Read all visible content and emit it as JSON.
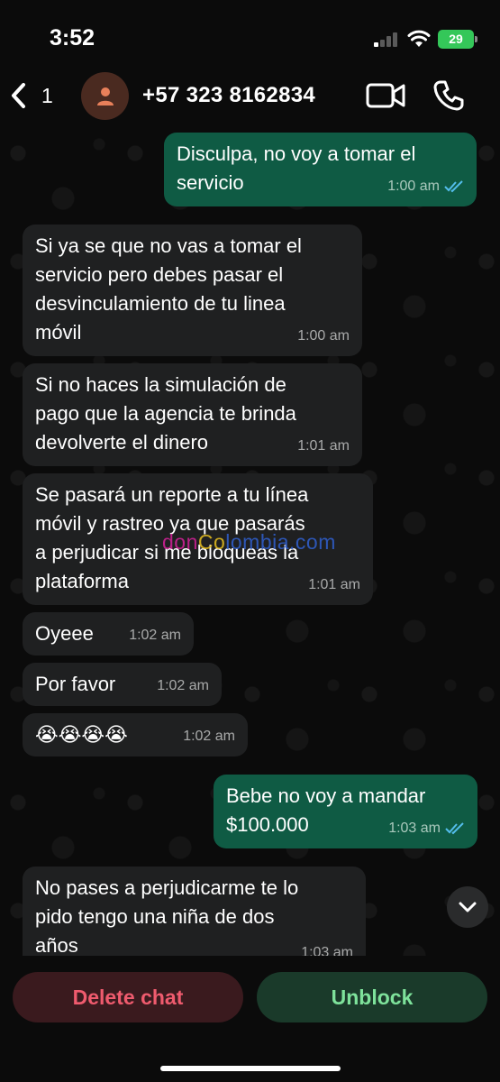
{
  "status_bar": {
    "time": "3:52",
    "battery": "29"
  },
  "header": {
    "back_count": "1",
    "contact": "+57 323 8162834"
  },
  "messages": [
    {
      "dir": "out",
      "text": "Disculpa, no voy a tomar el\nservicio",
      "time": "1:00 am",
      "read": true
    },
    {
      "dir": "in",
      "text": "Si ya se que no vas a tomar el\nservicio pero debes pasar el\ndesvinculamiento de tu linea\nmóvil",
      "time": "1:00 am"
    },
    {
      "dir": "in",
      "text": "Si no haces la simulación de\npago que la agencia te brinda\ndevolverte el dinero",
      "time": "1:01 am"
    },
    {
      "dir": "in",
      "text": "Se pasará un reporte a tu línea\nmóvil y rastreo ya que pasarás\na perjudicar si me bloqueas la\nplataforma",
      "time": "1:01 am"
    },
    {
      "dir": "in",
      "text": "Oyeee",
      "time": "1:02 am"
    },
    {
      "dir": "in",
      "text": "Por favor",
      "time": "1:02 am"
    },
    {
      "dir": "in",
      "text": "😭😭😭😭",
      "time": "1:02 am"
    },
    {
      "dir": "out",
      "text": "Bebe no voy a mandar\n$100.000",
      "time": "1:03 am",
      "read": true
    },
    {
      "dir": "in",
      "text": "No pases a perjudicarme te lo\npido tengo una niña de dos\naños",
      "time": "1:03 am"
    }
  ],
  "watermark": {
    "part1": "don",
    "part2": "Co",
    "part3": "lombia.com"
  },
  "actions": {
    "delete": "Delete chat",
    "unblock": "Unblock"
  },
  "colors": {
    "outgoing": "#0f5b44",
    "incoming": "#1f2021",
    "delete": "#ef5b6e",
    "unblock": "#7ee29b"
  }
}
